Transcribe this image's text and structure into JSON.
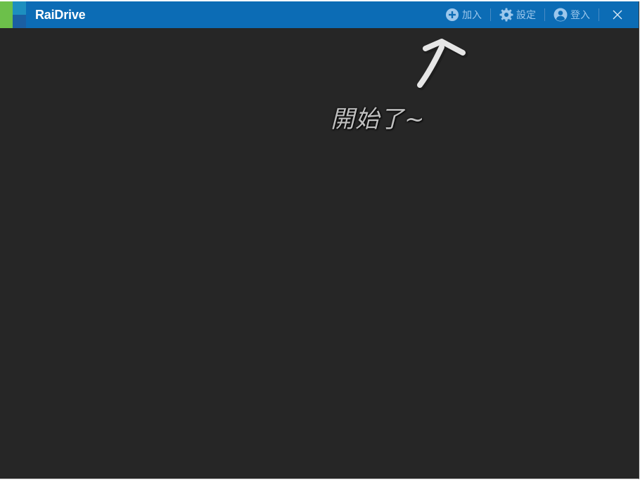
{
  "app": {
    "title": "RaiDrive"
  },
  "toolbar": {
    "add_label": "加入",
    "settings_label": "設定",
    "login_label": "登入"
  },
  "annotation": {
    "text": "開始了~"
  },
  "colors": {
    "titlebar": "#0c6cb5",
    "background": "#262626",
    "toolbar_text": "#9cc7ec",
    "logo_green": "#6cc04a",
    "logo_teal": "#1d8fbf",
    "logo_blue": "#1669a8"
  }
}
